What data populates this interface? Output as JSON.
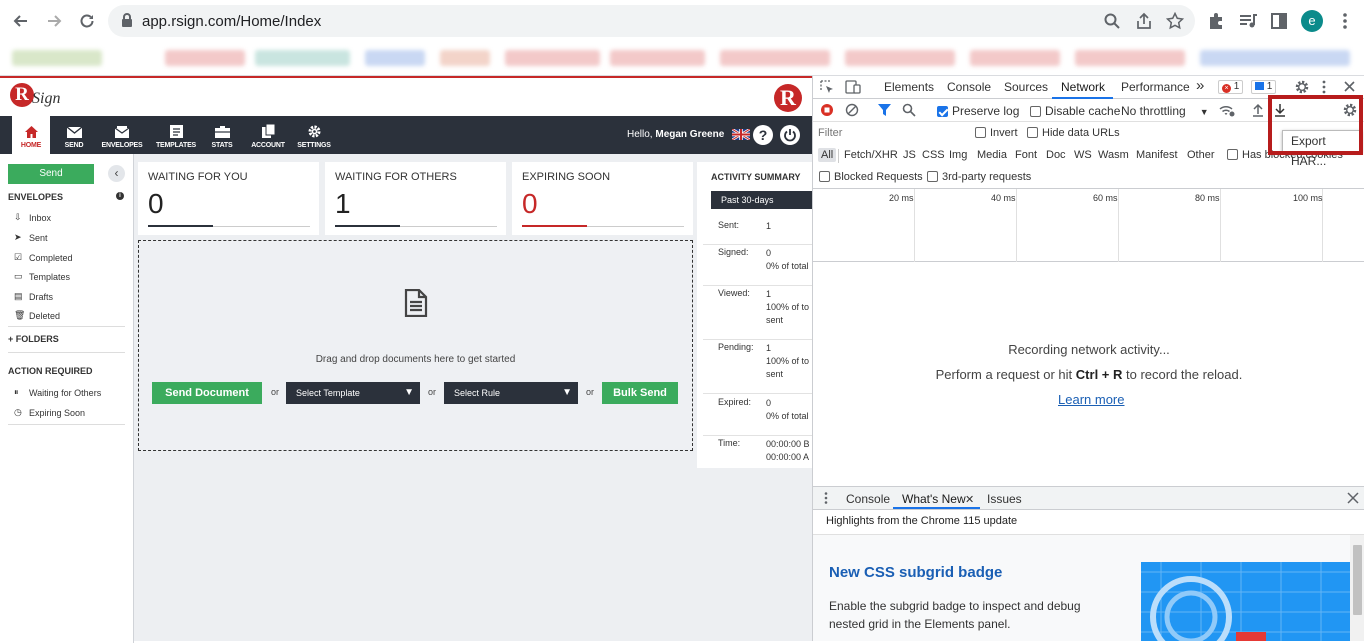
{
  "browser": {
    "url": "app.rsign.com/Home/Index",
    "avatar_letter": "e"
  },
  "app": {
    "logo_r": "R",
    "logo_text": "Sign",
    "brand_mark": "R",
    "nav": [
      {
        "label": "HOME",
        "icon": "home-icon"
      },
      {
        "label": "SEND",
        "icon": "envelope-icon"
      },
      {
        "label": "ENVELOPES",
        "icon": "envelopes-icon"
      },
      {
        "label": "TEMPLATES",
        "icon": "template-icon"
      },
      {
        "label": "STATS",
        "icon": "stats-icon"
      },
      {
        "label": "ACCOUNT",
        "icon": "account-icon"
      },
      {
        "label": "SETTINGS",
        "icon": "gear-icon"
      }
    ],
    "hello_prefix": "Hello,",
    "user_name": "Megan Greene",
    "help_symbol": "?",
    "sidebar": {
      "send_label": "Send",
      "collapse_symbol": "‹",
      "envelopes_heading": "ENVELOPES",
      "items": [
        {
          "label": "Inbox",
          "icon": "inbox-icon"
        },
        {
          "label": "Sent",
          "icon": "sent-icon"
        },
        {
          "label": "Completed",
          "icon": "completed-icon"
        },
        {
          "label": "Templates",
          "icon": "templates-icon"
        },
        {
          "label": "Drafts",
          "icon": "drafts-icon"
        },
        {
          "label": "Deleted",
          "icon": "trash-icon"
        }
      ],
      "folders_label": "FOLDERS",
      "action_heading": "ACTION REQUIRED",
      "action_items": [
        {
          "label": "Waiting for Others",
          "icon": "pause-icon"
        },
        {
          "label": "Expiring Soon",
          "icon": "clock-icon"
        }
      ]
    },
    "cards": [
      {
        "title": "WAITING FOR YOU",
        "value": "0"
      },
      {
        "title": "WAITING FOR OTHERS",
        "value": "1"
      },
      {
        "title": "EXPIRING SOON",
        "value": "0"
      }
    ],
    "dropzone": {
      "text": "Drag and drop documents here to get started",
      "send_document": "Send Document",
      "or": "or",
      "select_template": "Select Template",
      "select_rule": "Select Rule",
      "bulk_send": "Bulk Send"
    },
    "activity": {
      "title": "ACTIVITY SUMMARY",
      "period": "Past 30-days",
      "rows": [
        {
          "label": "Sent:",
          "lines": [
            "1"
          ]
        },
        {
          "label": "Signed:",
          "lines": [
            "0",
            "0% of total"
          ]
        },
        {
          "label": "Viewed:",
          "lines": [
            "1",
            "100% of to",
            "sent"
          ]
        },
        {
          "label": "Pending:",
          "lines": [
            "1",
            "100% of to",
            "sent"
          ]
        },
        {
          "label": "Expired:",
          "lines": [
            "0",
            "0% of total"
          ]
        },
        {
          "label": "Time:",
          "lines": [
            "00:00:00 B",
            "00:00:00 A"
          ]
        }
      ]
    }
  },
  "devtools": {
    "tabs": [
      "Elements",
      "Console",
      "Sources",
      "Network",
      "Performance"
    ],
    "more_tabs": "»",
    "error_count": "1",
    "message_count": "1",
    "preserve_log": "Preserve log",
    "disable_cache": "Disable cache",
    "throttling": "No throttling",
    "export_tooltip": "Export HAR...",
    "filter_placeholder": "Filter",
    "invert": "Invert",
    "hide_data_urls": "Hide data URLs",
    "types": [
      "All",
      "Fetch/XHR",
      "JS",
      "CSS",
      "Img",
      "Media",
      "Font",
      "Doc",
      "WS",
      "Wasm",
      "Manifest",
      "Other"
    ],
    "has_blocked_cookies": "Has blocked cookies",
    "blocked_requests": "Blocked Requests",
    "third_party": "3rd-party requests",
    "timeline_ticks": [
      "20 ms",
      "40 ms",
      "60 ms",
      "80 ms",
      "100 ms"
    ],
    "recording": "Recording network activity...",
    "perform_prefix": "Perform a request or hit",
    "shortcut": "Ctrl + R",
    "perform_suffix": "to record the reload.",
    "learn_more": "Learn more",
    "drawer_tabs": [
      "Console",
      "What's New",
      "Issues"
    ],
    "highlights": "Highlights from the Chrome 115 update",
    "whatsnew_title": "New CSS subgrid badge",
    "whatsnew_desc": "Enable the subgrid badge to inspect and debug nested grid in the Elements panel."
  }
}
